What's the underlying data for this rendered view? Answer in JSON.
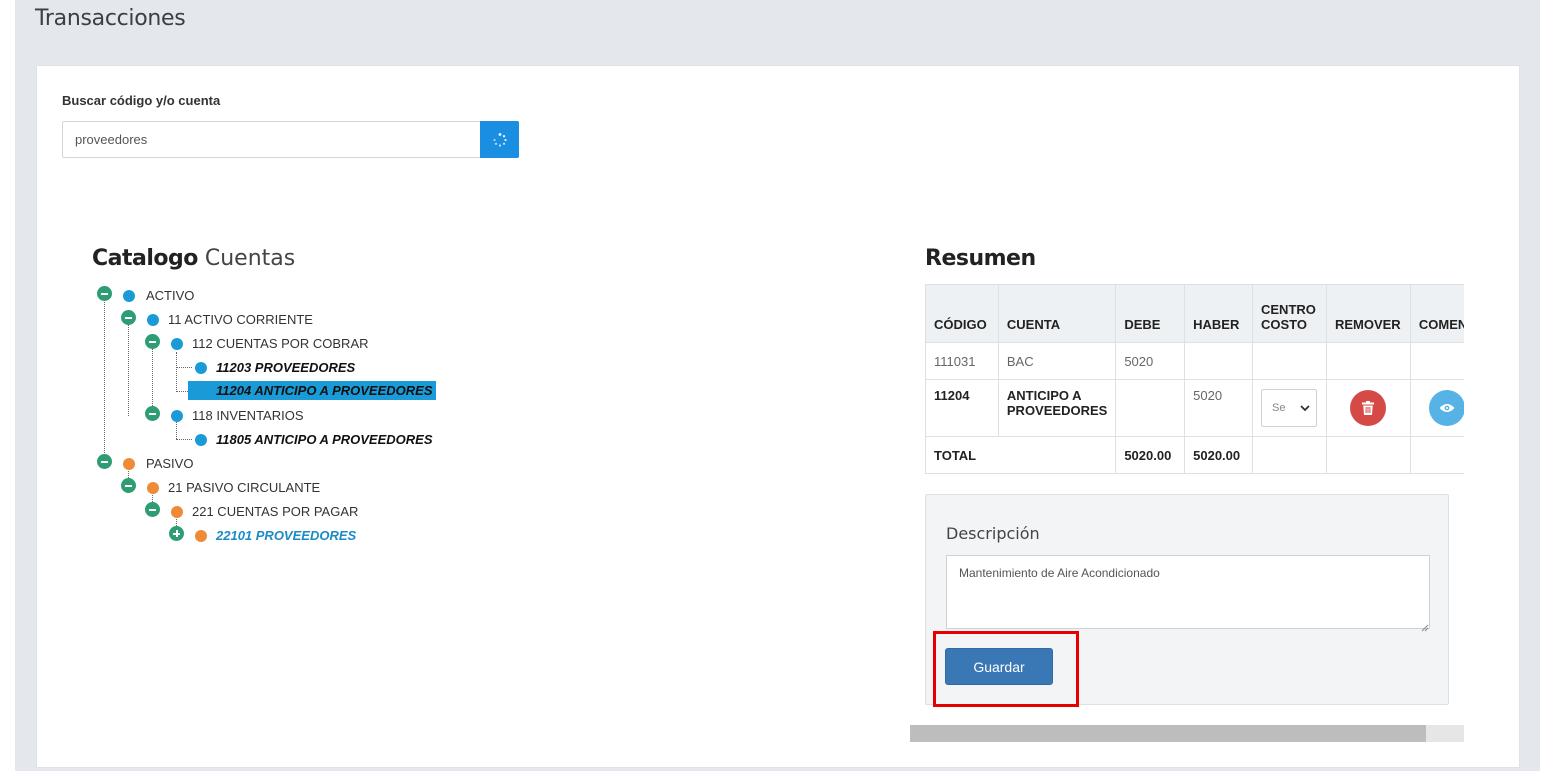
{
  "page": {
    "title": "Transacciones"
  },
  "search": {
    "label": "Buscar código y/o cuenta",
    "value": "proveedores",
    "button_icon": "spinner-icon"
  },
  "tree": {
    "title_bold": "Catalogo",
    "title_light": "Cuentas",
    "nodes": [
      {
        "label": "ACTIVO",
        "color": "blue",
        "toggle": "minus"
      },
      {
        "label": "11 ACTIVO CORRIENTE",
        "color": "blue",
        "toggle": "minus"
      },
      {
        "label": "112 CUENTAS POR COBRAR",
        "color": "blue",
        "toggle": "minus"
      },
      {
        "label": "11203 PROVEEDORES",
        "color": "blue",
        "style": "bold"
      },
      {
        "label": "11204 ANTICIPO A PROVEEDORES",
        "color": "blue",
        "style": "selected"
      },
      {
        "label": "118 INVENTARIOS",
        "color": "blue",
        "toggle": "minus"
      },
      {
        "label": "11805 ANTICIPO A PROVEEDORES",
        "color": "blue",
        "style": "bold"
      },
      {
        "label": "PASIVO",
        "color": "orange",
        "toggle": "minus"
      },
      {
        "label": "21 PASIVO CIRCULANTE",
        "color": "orange",
        "toggle": "minus"
      },
      {
        "label": "221 CUENTAS POR PAGAR",
        "color": "orange",
        "toggle": "minus"
      },
      {
        "label": "22101 PROVEEDORES",
        "color": "orange",
        "toggle": "plus",
        "style": "link"
      }
    ]
  },
  "resumen": {
    "title": "Resumen",
    "columns": [
      "CÓDIGO",
      "CUENTA",
      "DEBE",
      "HABER",
      "CENTRO COSTO",
      "REMOVER",
      "COMENTARIO"
    ],
    "rows": [
      {
        "codigo": "111031",
        "cuenta": "BAC",
        "debe": "5020",
        "haber": ""
      },
      {
        "codigo": "11204",
        "cuenta": "ANTICIPO A PROVEEDORES",
        "debe": "",
        "haber": "5020",
        "centro_costo": "Se"
      }
    ],
    "total": {
      "label": "TOTAL",
      "debe": "5020.00",
      "haber": "5020.00"
    }
  },
  "descripcion": {
    "label": "Descripción",
    "value": "Mantenimiento de Aire Acondicionado"
  },
  "actions": {
    "save_label": "Guardar"
  },
  "colors": {
    "accent": "#1a8ee0",
    "tree_blue": "#1a9bd7",
    "tree_orange": "#ef8a36",
    "toggle_green": "#2e9d74",
    "save_button": "#3a78b5",
    "highlight": "#e80000",
    "remove": "#d54a46"
  }
}
